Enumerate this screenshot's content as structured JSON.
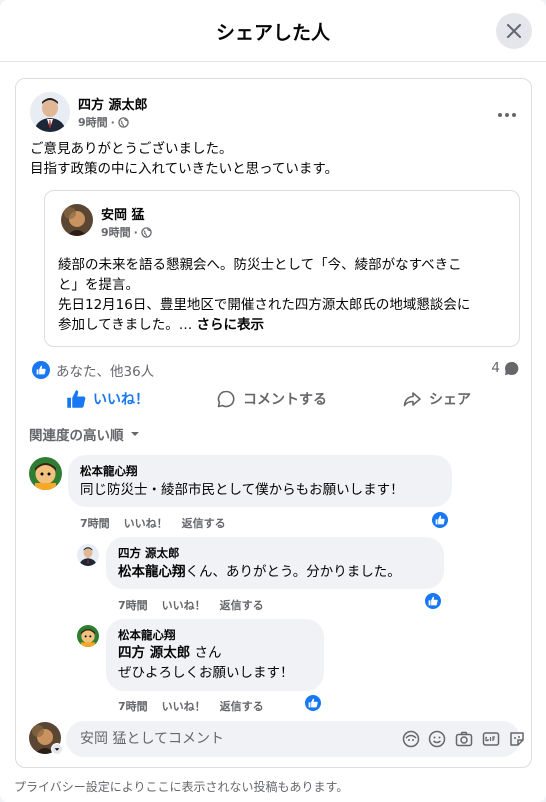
{
  "dialog": {
    "title": "シェアした人"
  },
  "post": {
    "author": "四方 源太郎",
    "time": "9時間",
    "text_lines": [
      "ご意見ありがとうございました。",
      "目指す政策の中に入れていきたいと思っています。"
    ]
  },
  "shared_post": {
    "author": "安岡 猛",
    "time": "9時間",
    "text_lines": [
      "綾部の未来を語る懇親会へ。防災士として「今、綾部がなすべきこ",
      "と」を提言。",
      "先日12月16日、豊里地区で開催された四方源太郎氏の地域懇談会に",
      "参加してきました。…"
    ],
    "see_more": "さらに表示"
  },
  "stats": {
    "likes": "あなた、他36人",
    "comments": "4"
  },
  "actions": {
    "like": "いいね！",
    "comment": "コメントする",
    "share": "シェア"
  },
  "sort": {
    "label": "関連度の高い順"
  },
  "comments": [
    {
      "author": "松本龍心翔",
      "text": "同じ防災士・綾部市民として僕からもお願いします！",
      "time": "7時間",
      "like": "いいね！",
      "reply": "返信する"
    },
    {
      "author": "四方 源太郎",
      "mention": "松本龍心翔",
      "text": "くん、ありがとう。分かりました。",
      "time": "7時間",
      "like": "いいね！",
      "reply": "返信する"
    },
    {
      "author": "松本龍心翔",
      "mention": "四方 源太郎",
      "text": " さん",
      "text2": "ぜひよろしくお願いします！",
      "time": "7時間",
      "like": "いいね！",
      "reply": "返信する"
    }
  ],
  "composer": {
    "placeholder": "安岡 猛としてコメント"
  },
  "footer": {
    "text": "プライバシー設定によりここに表示されない投稿もあります。"
  },
  "colors": {
    "accent": "#1877f2",
    "muted": "#65676b",
    "bubble": "#f0f2f5"
  }
}
